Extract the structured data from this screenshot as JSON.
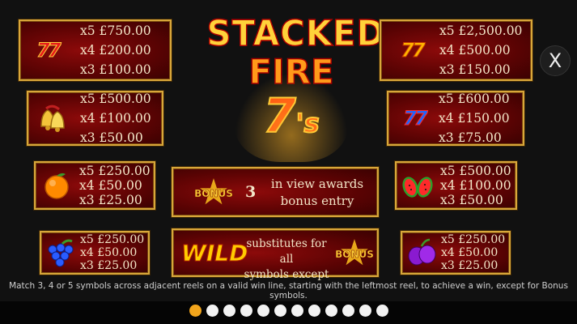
{
  "title": {
    "line1": "STACKED",
    "line2": "FIRE",
    "line3": "7",
    "line3_suffix": "'s"
  },
  "close_label": "X",
  "paytable": {
    "red_sevens": {
      "symbol": "77",
      "icon": "red-double-seven-icon",
      "pays": [
        "x5 £750.00",
        "x4 £200.00",
        "x3 £100.00"
      ]
    },
    "bells": {
      "icon": "bells-icon",
      "pays": [
        "x5 £500.00",
        "x4 £100.00",
        "x3 £50.00"
      ]
    },
    "orange": {
      "icon": "orange-icon",
      "pays": [
        "x5 £250.00",
        "x4 £50.00",
        "x3 £25.00"
      ]
    },
    "grapes": {
      "icon": "grapes-icon",
      "pays": [
        "x5 £250.00",
        "x4 £50.00",
        "x3 £25.00"
      ]
    },
    "gold_sevens": {
      "symbol": "77",
      "icon": "gold-double-seven-icon",
      "pays": [
        "x5 £2,500.00",
        "x4 £500.00",
        "x3 £150.00"
      ]
    },
    "blue_sevens": {
      "symbol": "77",
      "icon": "blue-double-seven-icon",
      "pays": [
        "x5 £600.00",
        "x4 £150.00",
        "x3 £75.00"
      ]
    },
    "watermelon": {
      "icon": "watermelon-icon",
      "pays": [
        "x5 £500.00",
        "x4 £100.00",
        "x3 £50.00"
      ]
    },
    "plums": {
      "icon": "plums-icon",
      "pays": [
        "x5 £250.00",
        "x4 £50.00",
        "x3 £25.00"
      ]
    }
  },
  "bonus": {
    "badge": "BONUS",
    "count": "3",
    "line1": "in view awards",
    "line2": "bonus entry"
  },
  "wild": {
    "badge": "WILD",
    "line1": "substitutes for all",
    "line2": "symbols except",
    "except_badge": "BONUS"
  },
  "footer": "Match 3, 4 or 5 symbols across adjacent reels on a valid win line, starting with the leftmost reel, to achieve a win, except for Bonus symbols.",
  "pagination": {
    "total": 12,
    "active": 1
  },
  "colors": {
    "panel_border": "#d9a73a",
    "panel_bg": "#7a0505",
    "active_dot": "#f2a51c",
    "dot": "#f2f2f2",
    "text": "#f3e6c8"
  }
}
